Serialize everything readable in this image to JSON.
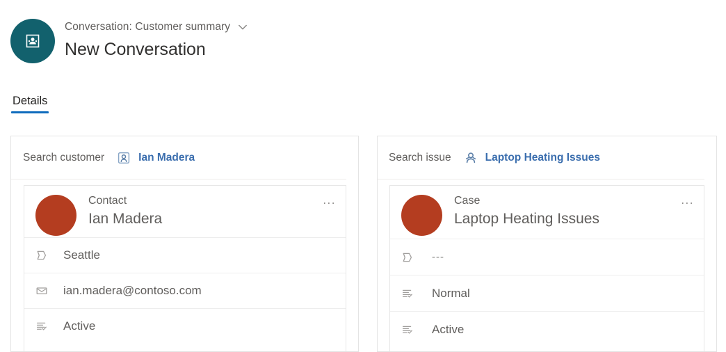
{
  "header": {
    "avatar_icon": "conversation-entity-icon",
    "subtitle": "Conversation: Customer summary",
    "chevron_icon": "chevron-down-icon",
    "title": "New Conversation"
  },
  "tabs": [
    {
      "label": "Details",
      "active": true
    }
  ],
  "colors": {
    "teal_avatar": "#12616d",
    "tab_accent": "#0f6cbd",
    "link_blue": "#3b6eae",
    "entity_avatar": "#b43d20",
    "label_gray": "#605e5c",
    "panel_border": "#e4e4e4"
  },
  "panels": [
    {
      "id": "customer",
      "search": {
        "label": "Search customer",
        "entity_icon": "contact-card-icon",
        "value": "Ian Madera"
      },
      "card": {
        "avatar_icon": "contact-avatar",
        "type": "Contact",
        "name": "Ian Madera",
        "overflow": "...",
        "fields": [
          {
            "icon": "address-icon",
            "value": "Seattle",
            "muted": false
          },
          {
            "icon": "email-icon",
            "value": "ian.madera@contoso.com",
            "muted": false
          },
          {
            "icon": "status-icon",
            "value": "Active",
            "muted": false
          }
        ]
      }
    },
    {
      "id": "issue",
      "search": {
        "label": "Search issue",
        "entity_icon": "case-person-icon",
        "value": "Laptop Heating Issues"
      },
      "card": {
        "avatar_icon": "case-avatar",
        "type": "Case",
        "name": "Laptop Heating Issues",
        "overflow": "...",
        "fields": [
          {
            "icon": "address-icon",
            "value": "---",
            "muted": true
          },
          {
            "icon": "priority-icon",
            "value": "Normal",
            "muted": false
          },
          {
            "icon": "status-icon",
            "value": "Active",
            "muted": false
          }
        ]
      }
    }
  ]
}
